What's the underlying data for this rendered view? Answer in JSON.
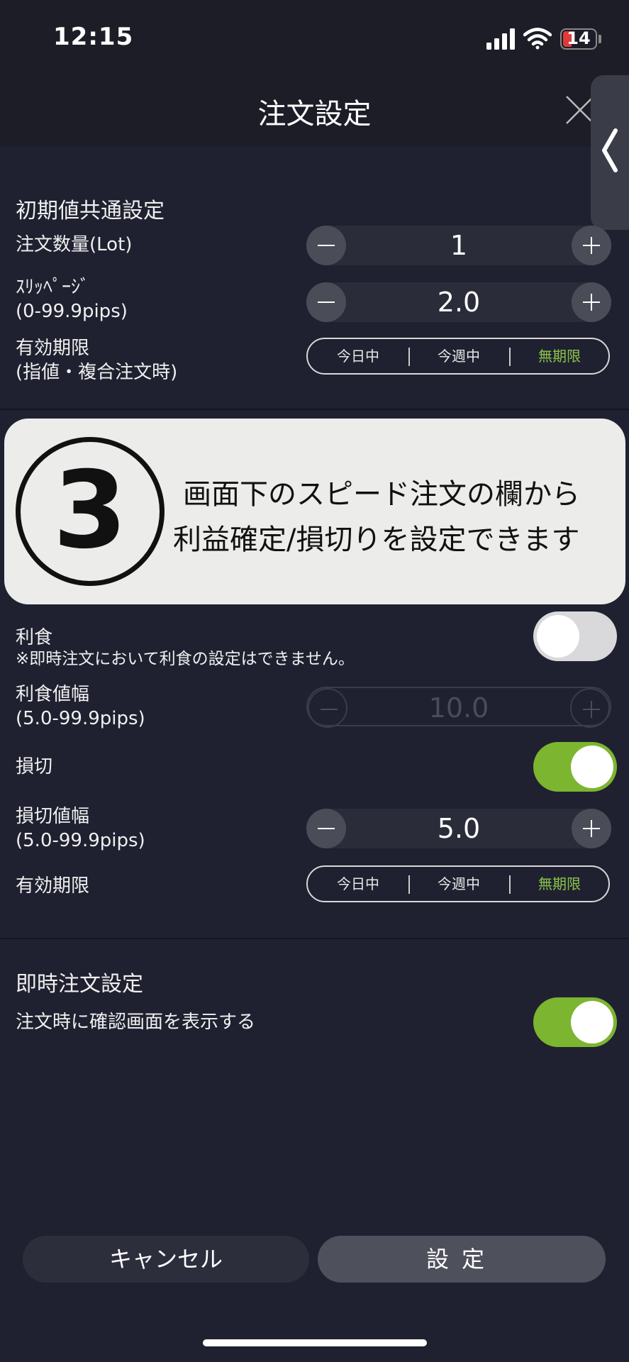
{
  "status_bar": {
    "time": "12:15",
    "battery": "14",
    "icons": [
      "signal-icon",
      "wifi-icon",
      "battery-icon"
    ]
  },
  "header": {
    "title": "注文設定",
    "close_icon": "close-icon",
    "side_tab_icon": "chevron-left-icon"
  },
  "initial_settings": {
    "title": "初期値共通設定",
    "quantity": {
      "label": "注文数量(Lot)",
      "value": "1"
    },
    "slippage": {
      "label1": "ｽﾘｯﾍﾟｰｼﾞ",
      "label2": "(0-99.9pips)",
      "value": "2.0"
    },
    "expiry": {
      "label1": "有効期限",
      "label2": "(指値・複合注文時)",
      "options": [
        "今日中",
        "今週中",
        "無期限"
      ],
      "selected": "無期限"
    }
  },
  "callout": {
    "number": "3",
    "line1": "画面下のスピード注文の欄から",
    "line2": "利益確定/損切りを設定できます"
  },
  "speed_order": {
    "take_profit": {
      "label": "利食",
      "note": "※即時注文において利食の設定はできません。",
      "on": false
    },
    "take_profit_width": {
      "label1": "利食値幅",
      "label2": "(5.0-99.9pips)",
      "value": "10.0"
    },
    "stop_loss": {
      "label": "損切",
      "on": true
    },
    "stop_loss_width": {
      "label1": "損切値幅",
      "label2": "(5.0-99.9pips)",
      "value": "5.0"
    },
    "expiry": {
      "label": "有効期限",
      "options": [
        "今日中",
        "今週中",
        "無期限"
      ],
      "selected": "無期限"
    }
  },
  "instant_order": {
    "title": "即時注文設定",
    "confirm": {
      "label": "注文時に確認画面を表示する",
      "on": true
    }
  },
  "footer": {
    "cancel_label": "キャンセル",
    "set_label": "設定"
  },
  "colors": {
    "background": "#1f2130",
    "accent_green": "#7cb530",
    "selected_text": "#8bc34a"
  }
}
